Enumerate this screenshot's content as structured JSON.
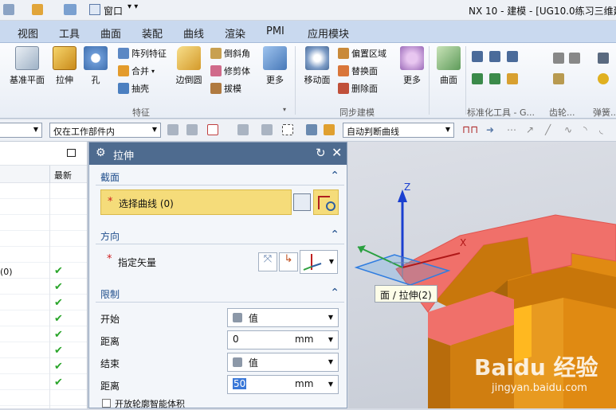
{
  "window": {
    "title": "NX 10 - 建模 - [UG10.0练习三维建"
  },
  "quick_access": {
    "window_menu": "窗口"
  },
  "menubar": {
    "items": [
      "视图",
      "工具",
      "曲面",
      "装配",
      "曲线",
      "渲染",
      "PMI",
      "应用模块"
    ]
  },
  "ribbon": {
    "feature_group": {
      "label": "特征",
      "datum_plane": "基准平面",
      "extrude": "拉伸",
      "hole": "孔",
      "pattern_feature": "阵列特征",
      "unite": "合并",
      "shell": "抽壳",
      "edge_blend": "边倒圆",
      "chamfer": "倒斜角",
      "trim_body": "修剪体",
      "draft": "拔模",
      "more": "更多"
    },
    "sync_group": {
      "label": "同步建模",
      "move_face": "移动面",
      "offset_region": "偏置区域",
      "replace_face": "替换面",
      "delete_face": "删除面",
      "more": "更多"
    },
    "surface_label": "曲面",
    "std_tools_label": "标准化工具 - G...",
    "gear_label": "齿轮...",
    "spring_label": "弹簧..."
  },
  "selection_bar": {
    "filter_scope": "仅在工作部件内",
    "curve_rule": "自动判断曲线"
  },
  "navigator": {
    "latest_header": "最新",
    "partial_row": "(0)",
    "checked_rows": 8
  },
  "dialog": {
    "title": "拉伸",
    "section": {
      "header": "截面",
      "select_curve": "选择曲线 (0)"
    },
    "direction": {
      "header": "方向",
      "specify_vector": "指定矢量"
    },
    "limits": {
      "header": "限制",
      "start_label": "开始",
      "start_value": "值",
      "start_distance_label": "距离",
      "start_distance": "0",
      "start_unit": "mm",
      "end_label": "结束",
      "end_value": "值",
      "end_distance_label": "距离",
      "end_distance": "50",
      "end_unit": "mm",
      "open_profile": "开放轮廓智能体积"
    }
  },
  "viewport": {
    "tooltip": "面 / 拉伸(2)",
    "axis_z": "Z",
    "axis_x": "X",
    "watermark_brand": "Baidu 经验",
    "watermark_url": "jingyan.baidu.com"
  },
  "colors": {
    "title_bar": "#4e6b8f",
    "highlight_field": "#f5dc7a",
    "model_orange": "#e08a12",
    "model_highlight": "#f0706a",
    "section_header": "#1f4e8c"
  }
}
